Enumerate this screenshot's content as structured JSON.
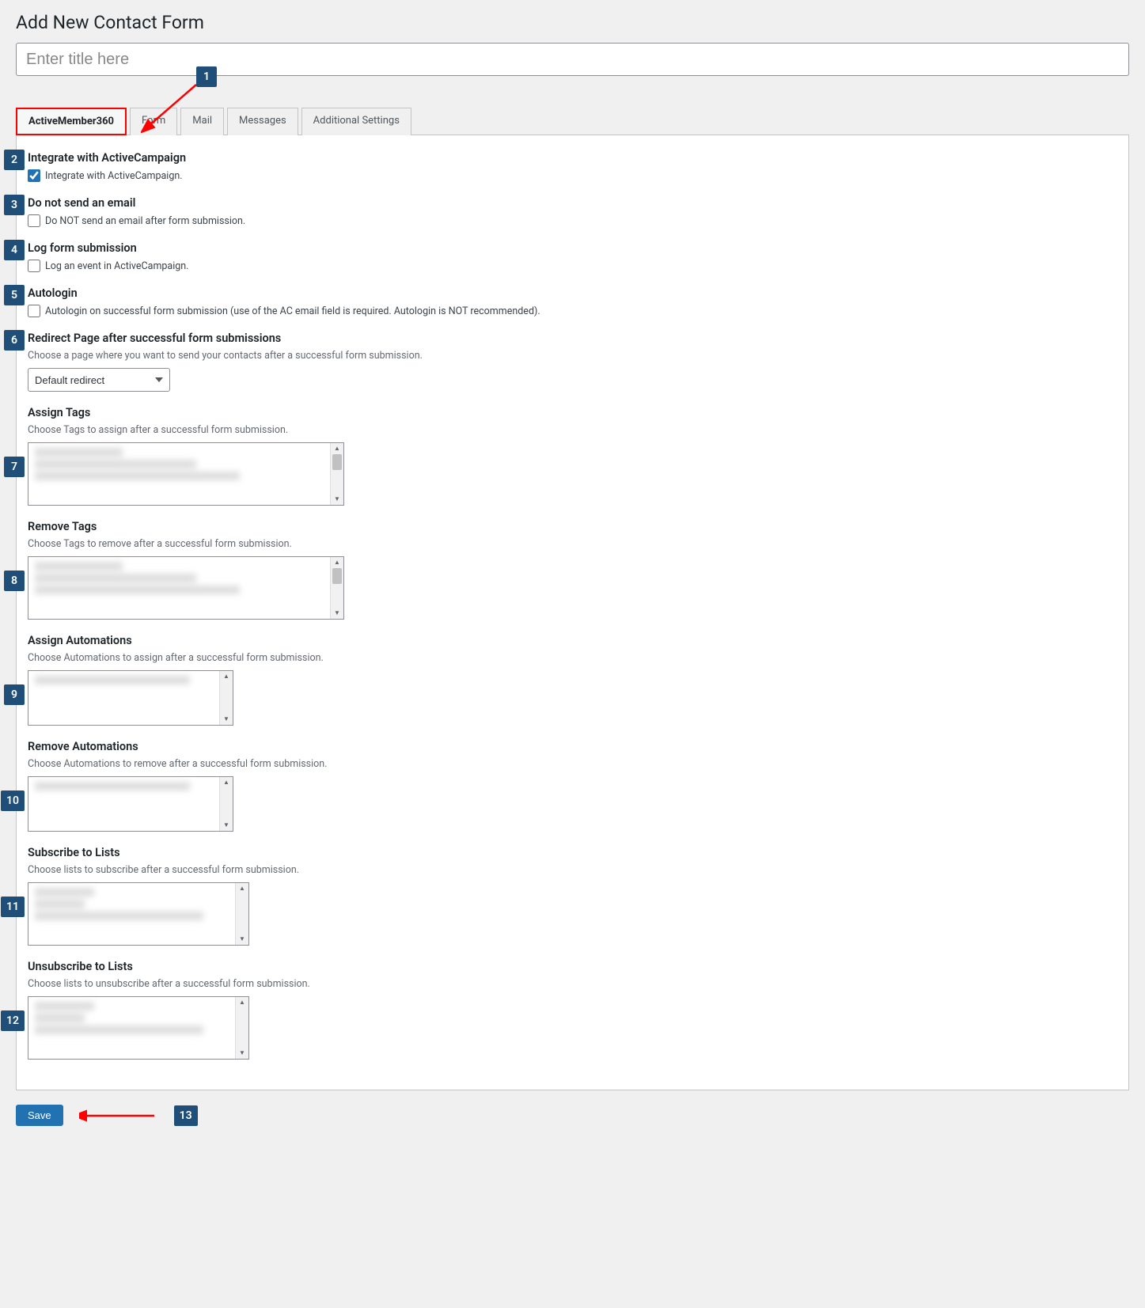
{
  "page_title": "Add New Contact Form",
  "title_placeholder": "Enter title here",
  "tabs": [
    {
      "label": "ActiveMember360"
    },
    {
      "label": "Form"
    },
    {
      "label": "Mail"
    },
    {
      "label": "Messages"
    },
    {
      "label": "Additional Settings"
    }
  ],
  "sections": {
    "integrate": {
      "heading": "Integrate with ActiveCampaign",
      "checkbox_label": "Integrate with ActiveCampaign.",
      "checked": true
    },
    "no_email": {
      "heading": "Do not send an email",
      "checkbox_label": "Do NOT send an email after form submission.",
      "checked": false
    },
    "log_submission": {
      "heading": "Log form submission",
      "checkbox_label": "Log an event in ActiveCampaign.",
      "checked": false
    },
    "autologin": {
      "heading": "Autologin",
      "checkbox_label": "Autologin on successful form submission (use of the AC email field is required. Autologin is NOT recommended).",
      "checked": false
    },
    "redirect": {
      "heading": "Redirect Page after successful form submissions",
      "help": "Choose a page where you want to send your contacts after a successful form submission.",
      "select_value": "Default redirect"
    },
    "assign_tags": {
      "heading": "Assign Tags",
      "help": "Choose Tags to assign after a successful form submission."
    },
    "remove_tags": {
      "heading": "Remove Tags",
      "help": "Choose Tags to remove after a successful form submission."
    },
    "assign_automations": {
      "heading": "Assign Automations",
      "help": "Choose Automations to assign after a successful form submission."
    },
    "remove_automations": {
      "heading": "Remove Automations",
      "help": "Choose Automations to remove after a successful form submission."
    },
    "subscribe_lists": {
      "heading": "Subscribe to Lists",
      "help": "Choose lists to subscribe after a successful form submission."
    },
    "unsubscribe_lists": {
      "heading": "Unsubscribe to Lists",
      "help": "Choose lists to unsubscribe after a successful form submission."
    }
  },
  "save_label": "Save",
  "callouts": [
    "1",
    "2",
    "3",
    "4",
    "5",
    "6",
    "7",
    "8",
    "9",
    "10",
    "11",
    "12",
    "13"
  ]
}
